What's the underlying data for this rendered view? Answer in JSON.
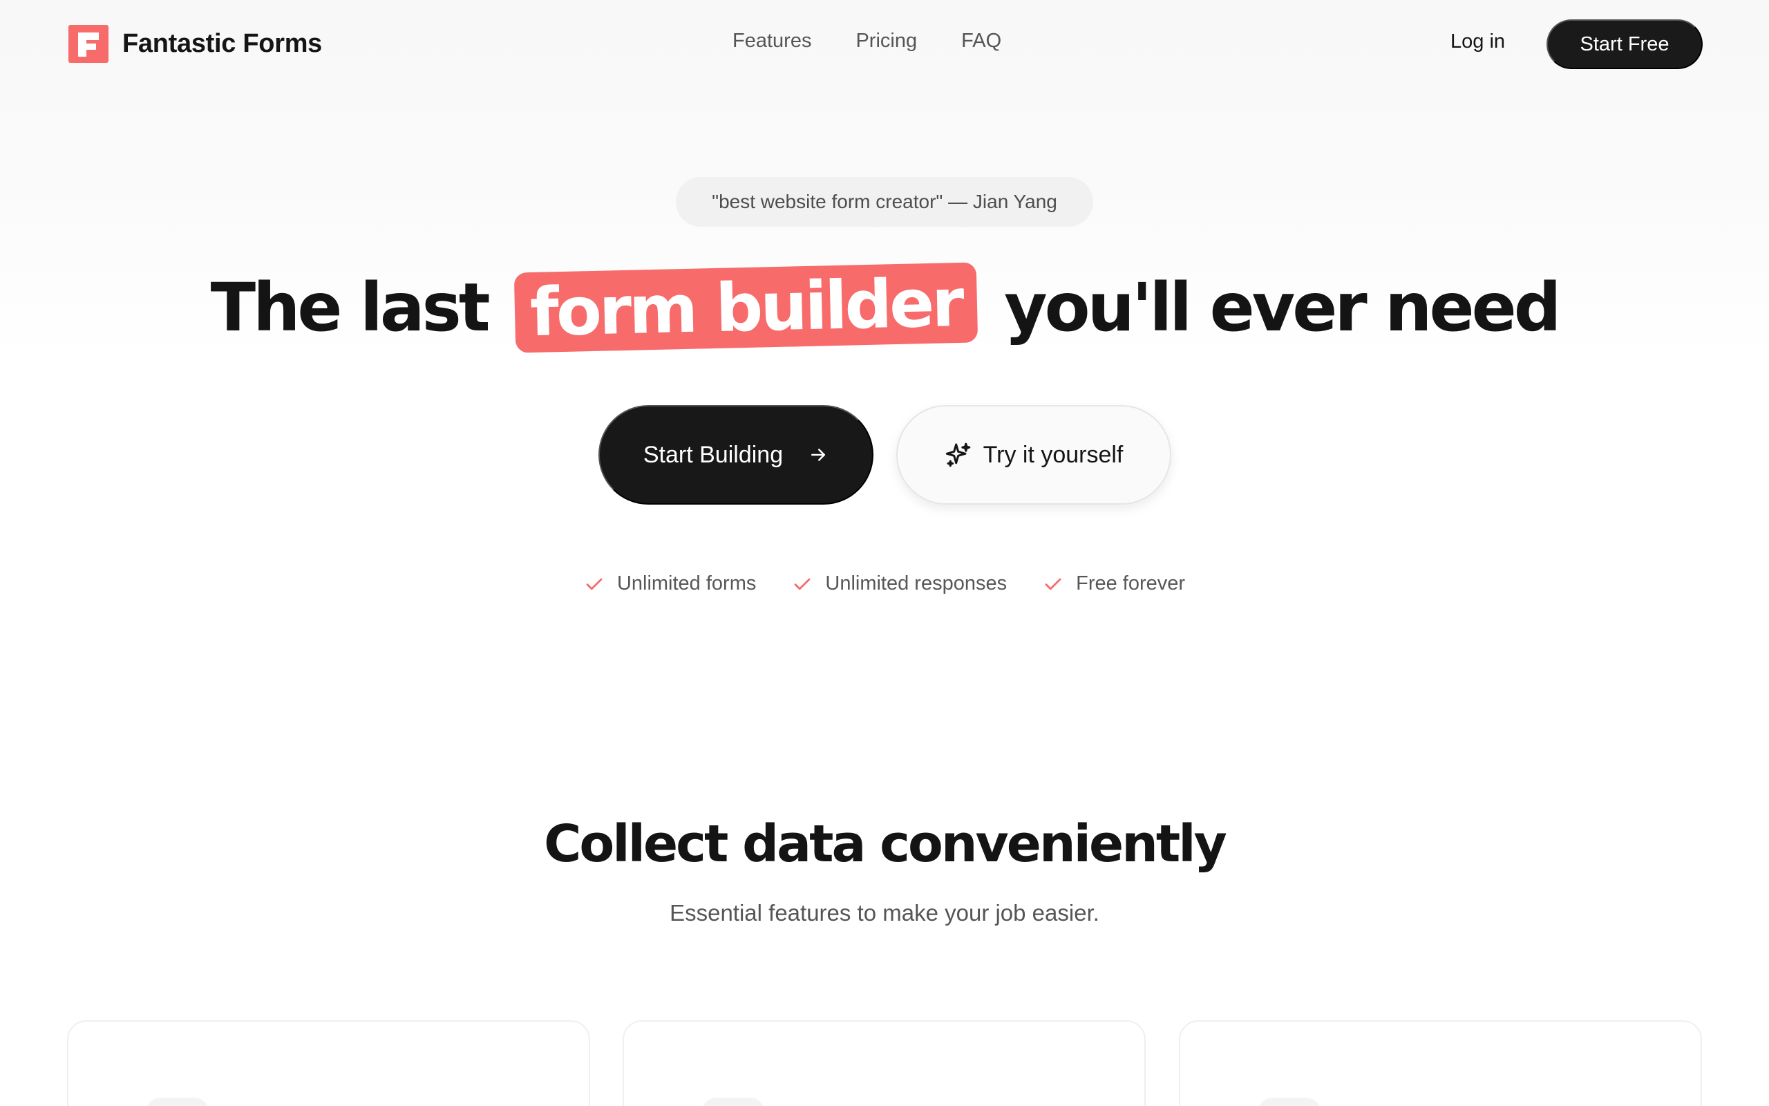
{
  "brand": {
    "name": "Fantastic Forms",
    "accent": "#f76b6b",
    "dark": "#181818"
  },
  "nav": {
    "links": [
      "Features",
      "Pricing",
      "FAQ"
    ],
    "login": "Log in",
    "cta": "Start Free"
  },
  "hero": {
    "quote": "\"best website form creator\" — Jian Yang",
    "headline_pre": "The last",
    "headline_highlight": "form builder",
    "headline_post": "you'll ever need",
    "primary_cta": "Start Building",
    "secondary_cta": "Try it yourself",
    "features": [
      "Unlimited forms",
      "Unlimited responses",
      "Free forever"
    ]
  },
  "section": {
    "title": "Collect data conveniently",
    "subtitle": "Essential features to make your job easier."
  },
  "icons": {
    "logo": "logo-f-icon",
    "arrow": "arrow-right-icon",
    "sparkle": "sparkle-icon",
    "check": "check-icon"
  }
}
